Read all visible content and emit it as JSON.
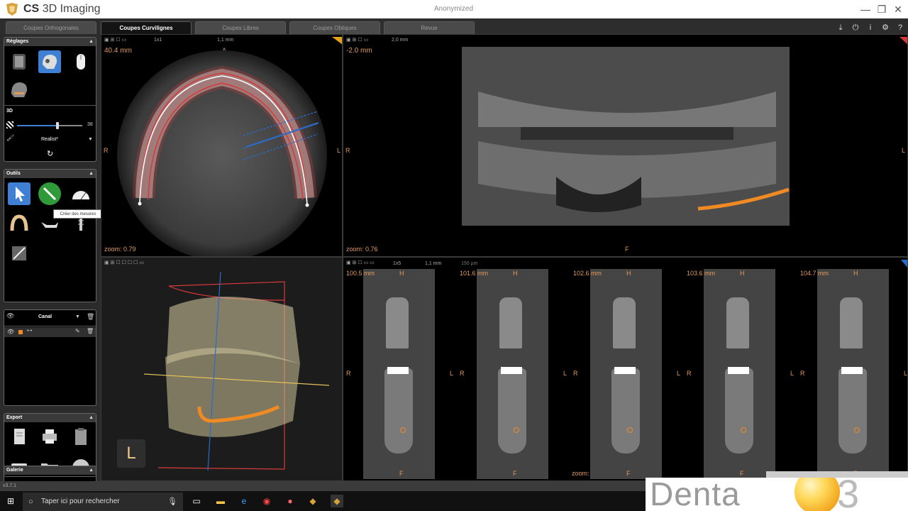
{
  "window": {
    "app_name_brand": "CS",
    "app_name_product": "3D Imaging",
    "document": "Anonymized",
    "minimize": "—",
    "maximize": "❐",
    "close": "✕"
  },
  "tabs": [
    "Coupes Orthogonales",
    "Coupes Curvilignes",
    "Coupes Libres",
    "Coupes Obliques",
    "Revue"
  ],
  "active_tab": "Coupes Curvilignes",
  "top_right_icons": [
    "download-icon",
    "power-icon",
    "info-icon",
    "gear-icon",
    "help-icon"
  ],
  "sidebar": {
    "reglages": {
      "title": "Réglages",
      "tools": [
        "skull-view-icon",
        "skull-side-icon",
        "mouse-icon",
        "skull-profile-icon"
      ],
      "label_3d": "3D",
      "slider_value": "38",
      "slider_level": 0.62,
      "render_mode": "Realist*",
      "reset_icon": "rotate-icon"
    },
    "outils": {
      "title": "Outils",
      "tools": [
        "pointer-icon",
        "measure-icon",
        "protractor-icon",
        "dental-arch-icon",
        "jaw-icon",
        "implant-icon",
        "contrast-icon"
      ],
      "tooltip": "Créer des mesures"
    },
    "canal": {
      "label": "Canal"
    },
    "export": {
      "title": "Export",
      "tools": [
        "document-icon",
        "printer-icon",
        "clipboard-icon",
        "camera-icon",
        "folder-icon",
        "cd-icon"
      ]
    },
    "galerie": {
      "title": "Galerie"
    }
  },
  "views": {
    "axial": {
      "slice_label": "1x1",
      "thickness": "1,1 mm",
      "position": "40.4 mm",
      "zoom": "zoom: 0.79",
      "top": "A",
      "bottom": "P",
      "left": "R",
      "right": "L"
    },
    "panoramic": {
      "thickness": "2,0 mm",
      "position": "-2.0 mm",
      "zoom": "zoom: 0.76",
      "top": "H",
      "bottom": "F",
      "left": "R",
      "right": "L"
    },
    "volume": {
      "orientation": "L"
    },
    "cross": {
      "slice_label": "1x5",
      "thickness": "1,1 mm",
      "spacing": "150 µm",
      "zoom": "zoom: 0.76",
      "slices": [
        {
          "position": "100.5 mm",
          "top": "H",
          "bottom": "F",
          "left": "R",
          "right": "L"
        },
        {
          "position": "101.6 mm",
          "top": "H",
          "bottom": "F",
          "left": "R",
          "right": "L"
        },
        {
          "position": "102.6 mm",
          "top": "H",
          "bottom": "F",
          "left": "R",
          "right": "L"
        },
        {
          "position": "103.6 mm",
          "top": "H",
          "bottom": "F",
          "left": "R",
          "right": "L"
        },
        {
          "position": "104.7 mm",
          "top": "H",
          "bottom": "F",
          "left": "R",
          "right": "L"
        }
      ]
    }
  },
  "status_version": "v3.7.1",
  "taskbar": {
    "search_placeholder": "Taper ici pour rechercher"
  },
  "watermark": {
    "text": "Denta",
    "suffix": "3"
  },
  "colors": {
    "accent_orange": "#e29a5b",
    "canal_orange": "#f08a23",
    "selection_blue": "#2a6cc8",
    "arch_red": "#d73a3a"
  }
}
